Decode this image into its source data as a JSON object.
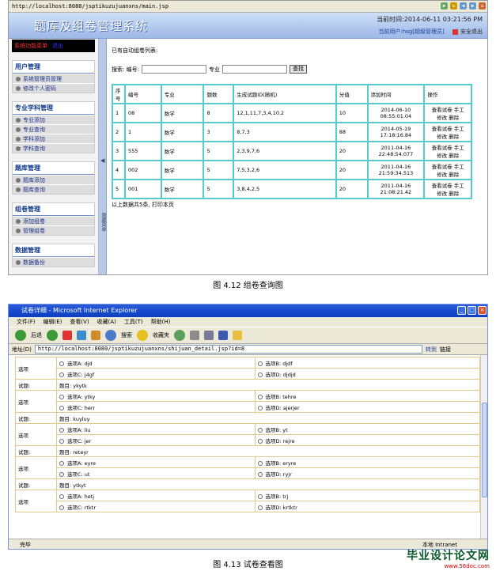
{
  "shot1": {
    "address": "http://localhost:8080/jsptikuzujuanxns/main.jsp",
    "banner_title": "题库及组卷管理系统",
    "current_time": "当前时间:2014-06-11  03:21:56 PM",
    "user_prefix": "当前用户:",
    "user_name": "hsg[超级管理员]",
    "logout": "安全退出",
    "sidebar_top_a": "系统功能菜单",
    "sidebar_top_b": "退出",
    "groups": [
      {
        "header": "用户管理",
        "items": [
          "系统管理员管理",
          "修改个人密码"
        ]
      },
      {
        "header": "专业学科管理",
        "items": [
          "专业添加",
          "专业查询",
          "学科添加",
          "学科查询"
        ]
      },
      {
        "header": "题库管理",
        "items": [
          "题库添加",
          "题库查询"
        ]
      },
      {
        "header": "组卷管理",
        "items": [
          "添加组卷",
          "管理组卷"
        ]
      },
      {
        "header": "数据管理",
        "items": [
          "数据备份"
        ]
      }
    ],
    "splitter_text": "隐藏菜单",
    "list_caption": "已有自动组卷列表:",
    "search_label1": "搜索: 编号:",
    "search_label2": "专业",
    "search_button": "查找",
    "columns": [
      "序号",
      "编号",
      "专业",
      "题数",
      "生成试题ID(随机)",
      "分值",
      "添加时间",
      "操作"
    ],
    "rows": [
      {
        "no": "1",
        "code": "08",
        "major": "数学",
        "count": "8",
        "ids": "12,1,11,7,3,4,10,2",
        "score": "10",
        "time1": "2014-06-10",
        "time2": "08:55:01.04",
        "op1": "查看试卷 手工",
        "op2": "修改 删除"
      },
      {
        "no": "2",
        "code": "1",
        "major": "数学",
        "count": "3",
        "ids": "8,7,3",
        "score": "88",
        "time1": "2014-05-19",
        "time2": "17:18:16.84",
        "op1": "查看试卷 手工",
        "op2": "修改 删除"
      },
      {
        "no": "3",
        "code": "555",
        "major": "数学",
        "count": "5",
        "ids": "2,3,9,7,6",
        "score": "20",
        "time1": "2011-04-16",
        "time2": "22:48:54.077",
        "op1": "查看试卷 手工",
        "op2": "修改 删除"
      },
      {
        "no": "4",
        "code": "002",
        "major": "数学",
        "count": "5",
        "ids": "7,5,3,2,6",
        "score": "20",
        "time1": "2011-04-16",
        "time2": "21:59:34.513",
        "op1": "查看试卷 手工",
        "op2": "修改 删除"
      },
      {
        "no": "5",
        "code": "001",
        "major": "数学",
        "count": "5",
        "ids": "3,8,4,2,5",
        "score": "20",
        "time1": "2011-04-16",
        "time2": "21:08:21.42",
        "op1": "查看试卷 手工",
        "op2": "修改 删除"
      }
    ],
    "footer": "以上数据共5条, 打印本页"
  },
  "caption1": "图 4.12 组卷查询图",
  "shot2": {
    "title": "试卷详细 - Microsoft Internet Explorer",
    "menu": [
      "文件(F)",
      "编辑(E)",
      "查看(V)",
      "收藏(A)",
      "工具(T)",
      "帮助(H)"
    ],
    "back": "后退",
    "search": "搜索",
    "favorites": "收藏夹",
    "address_label": "地址(D)",
    "address": "http://localhost:8080/jsptikuzujuanxns/shijuan_detail.jsp?id=8",
    "go": "转到",
    "links": "链接",
    "opt_label": "选项",
    "q_label": "试题:",
    "blocks": [
      {
        "question": "",
        "a": "选项A: djd",
        "b": "选项B: djdf",
        "c": "选项C: j4gf",
        "d": "选项D: djdjd"
      },
      {
        "question": "题目: ykytk",
        "a": "选项A: ytky",
        "b": "选项B: tehre",
        "c": "选项C: herr",
        "d": "选项D: ajerjer"
      },
      {
        "question": "题目: kuyluy",
        "a": "选项A: liu",
        "b": "选项B: yt",
        "c": "选项C: jer",
        "d": "选项D: rejre"
      },
      {
        "question": "题目: reteyr",
        "a": "选项A: eyre",
        "b": "选项B: eryre",
        "c": "选项C: ut",
        "d": "选项D: ryjr"
      },
      {
        "question": "题目: ytkyt",
        "a": "选项A: hetj",
        "b": "选项B: trj",
        "c": "选项C: rtktr",
        "d": "选项D: krtktr"
      }
    ],
    "status_left": "完毕",
    "status_right": "本地 Intranet"
  },
  "caption2": "图 4.13 试卷查看图",
  "logo_big": "毕业设计论文网",
  "logo_small": "www.56doc.com"
}
